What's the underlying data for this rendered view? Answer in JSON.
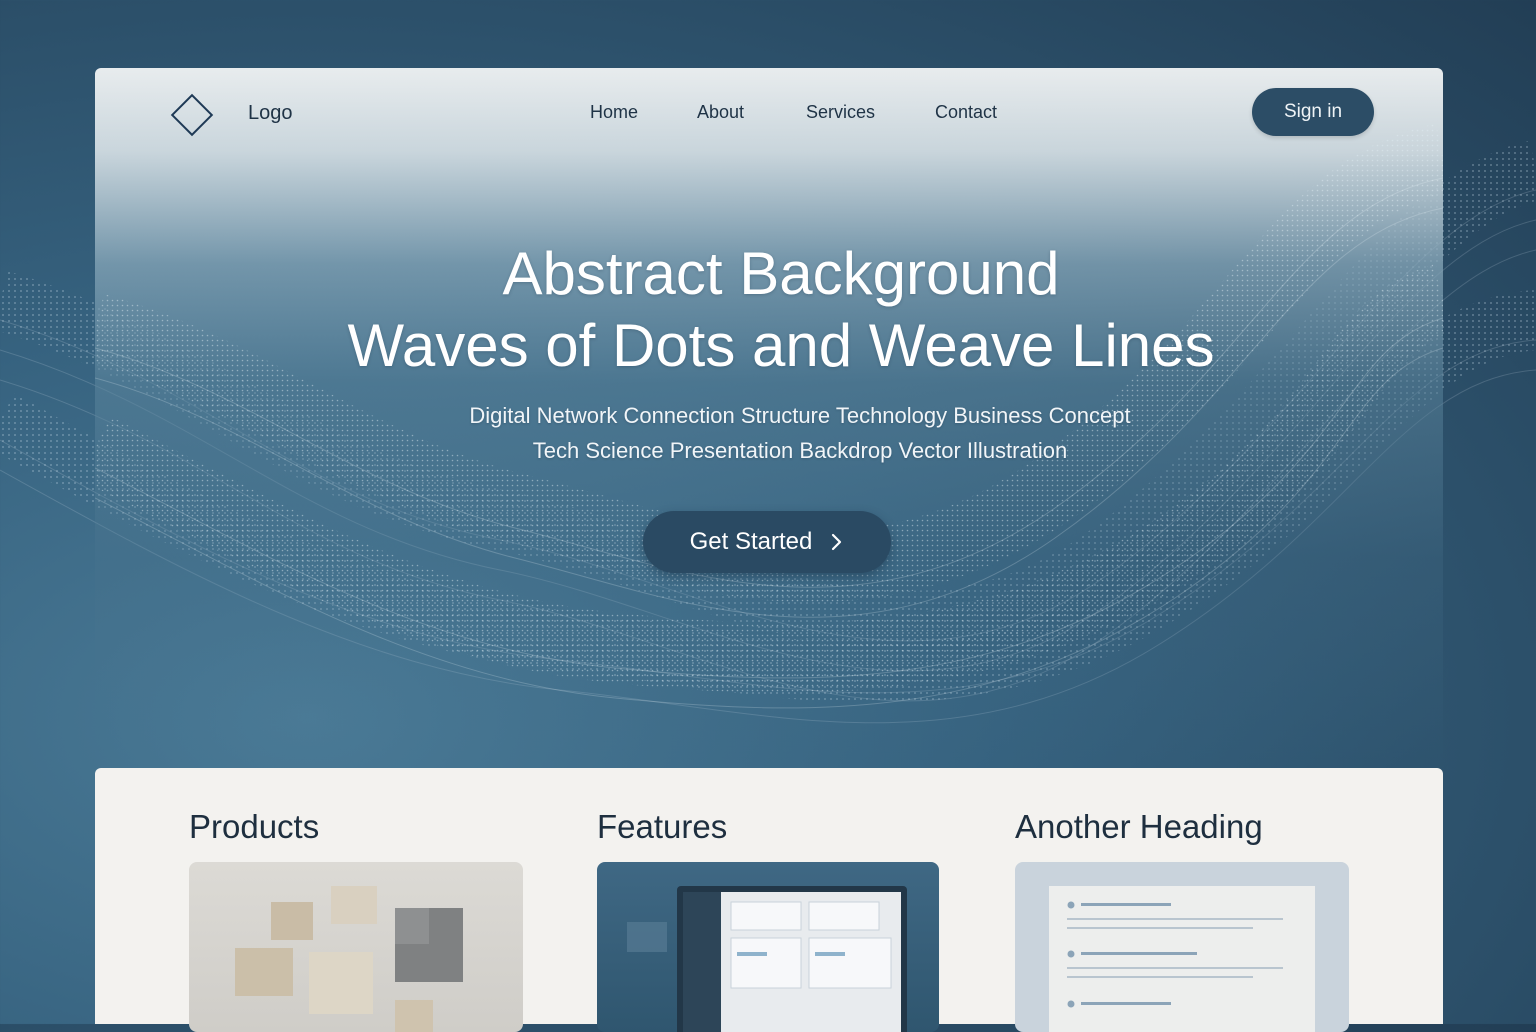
{
  "brand": {
    "logo_text": "Logo",
    "logo_icon": "diamond-icon"
  },
  "nav": {
    "items": [
      "Home",
      "About",
      "Services",
      "Contact"
    ]
  },
  "header": {
    "signin_label": "Sign in"
  },
  "hero": {
    "title_line1": "Abstract Background",
    "title_line2": "Waves of Dots and Weave Lines",
    "subtitle_line1": "Digital Network Connection Structure Technology Business Concept",
    "subtitle_line2": "Tech Science Presentation Backdrop Vector Illustration",
    "cta_label": "Get Started",
    "cta_icon": "chevron-right-icon"
  },
  "sections": [
    {
      "title": "Products",
      "image": "product-blocks-image"
    },
    {
      "title": "Features",
      "image": "dashboard-screen-image"
    },
    {
      "title": "Another Heading",
      "image": "document-list-image"
    }
  ],
  "colors": {
    "accent": "#2c4d66",
    "background": "#36627f",
    "card": "#f3f2ef",
    "text_dark": "#1f3346"
  }
}
